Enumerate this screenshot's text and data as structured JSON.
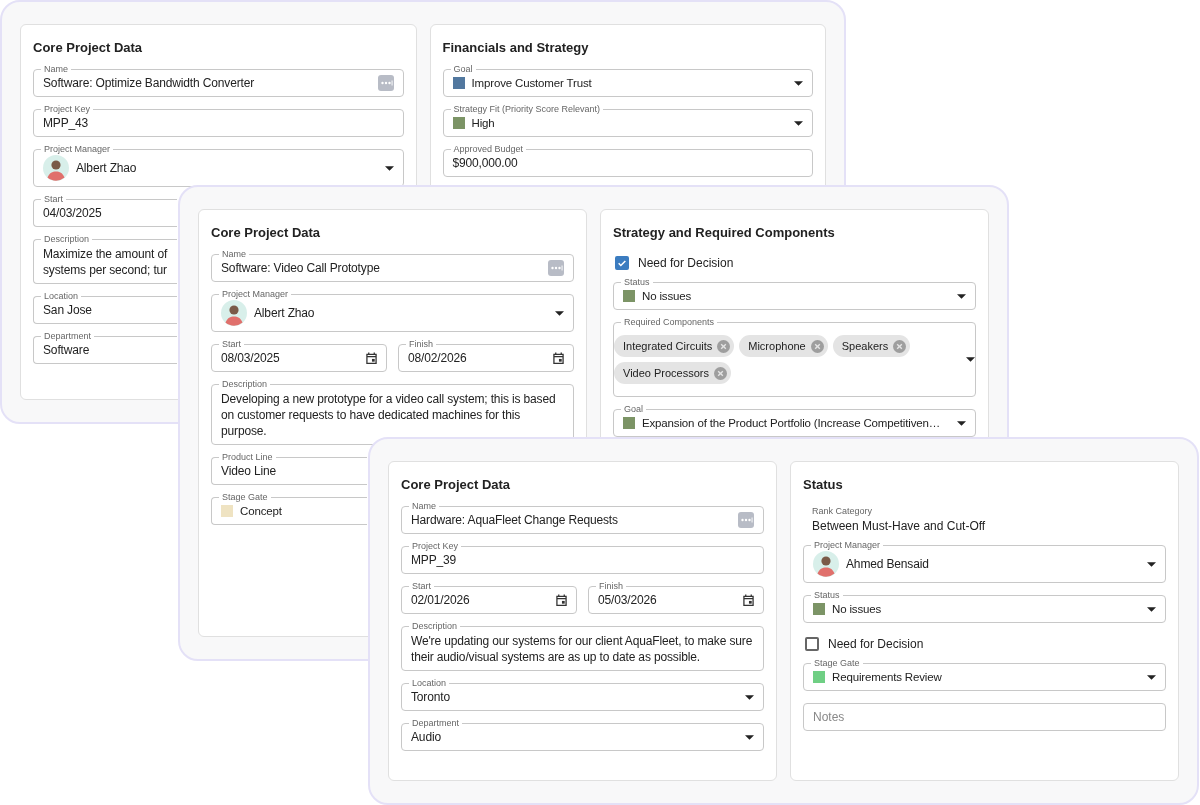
{
  "windows": [
    {
      "cards": [
        {
          "title": "Core Project Data",
          "fields": [
            {
              "kind": "name",
              "label": "Name",
              "value": "Software: Optimize Bandwidth Converter"
            },
            {
              "kind": "text",
              "label": "Project Key",
              "value": "MPP_43",
              "dropdown": false
            },
            {
              "kind": "person",
              "label": "Project Manager",
              "value": "Albert Zhao",
              "dropdown": true
            },
            {
              "kind": "text",
              "label": "Start",
              "value": "04/03/2025",
              "dropdown": false
            },
            {
              "kind": "textarea",
              "label": "Description",
              "value": "Maximize the amount of\nsystems per second; tur"
            },
            {
              "kind": "text",
              "label": "Location",
              "value": "San Jose",
              "dropdown": false
            },
            {
              "kind": "text",
              "label": "Department",
              "value": "Software",
              "dropdown": false
            }
          ]
        },
        {
          "title": "Financials and Strategy",
          "fields": [
            {
              "kind": "color",
              "label": "Goal",
              "value": "Improve Customer Trust",
              "color": "#52789f",
              "dropdown": true
            },
            {
              "kind": "color",
              "label": "Strategy Fit (Priority Score Relevant)",
              "value": "High",
              "color": "#7c9466",
              "dropdown": true
            },
            {
              "kind": "text",
              "label": "Approved Budget",
              "value": "$900,000.00",
              "dropdown": false
            }
          ]
        }
      ]
    },
    {
      "cards": [
        {
          "title": "Core Project Data",
          "fields": [
            {
              "kind": "name",
              "label": "Name",
              "value": "Software: Video Call Prototype"
            },
            {
              "kind": "person",
              "label": "Project Manager",
              "value": "Albert Zhao",
              "dropdown": true
            },
            {
              "kind": "dates",
              "fields": [
                {
                  "label": "Start",
                  "value": "08/03/2025"
                },
                {
                  "label": "Finish",
                  "value": "08/02/2026"
                }
              ]
            },
            {
              "kind": "textarea",
              "label": "Description",
              "value": "Developing a new prototype for a video call system; this is based on customer requests to have dedicated machines for this purpose."
            },
            {
              "kind": "text",
              "label": "Product Line",
              "value": "Video Line",
              "dropdown": false
            },
            {
              "kind": "color",
              "label": "Stage Gate",
              "value": "Concept",
              "color": "#efe3c2",
              "dropdown": false
            }
          ]
        },
        {
          "title": "Strategy and Required Components",
          "fields": [
            {
              "kind": "checkbox",
              "label": "Need for Decision",
              "checked": true
            },
            {
              "kind": "color",
              "label": "Status",
              "value": "No issues",
              "color": "#7c9466",
              "dropdown": true
            },
            {
              "kind": "chips",
              "label": "Required Components",
              "items": [
                "Integrated Circuits",
                "Microphone",
                "Speakers",
                "Video Processors"
              ],
              "dropdown": true
            },
            {
              "kind": "color",
              "label": "Goal",
              "value": "Expansion of the Product Portfolio (Increase Competitiven…",
              "color": "#7c9466",
              "dropdown": true
            }
          ]
        }
      ]
    },
    {
      "cards": [
        {
          "title": "Core Project Data",
          "fields": [
            {
              "kind": "name",
              "label": "Name",
              "value": "Hardware: AquaFleet Change Requests"
            },
            {
              "kind": "text",
              "label": "Project Key",
              "value": "MPP_39",
              "dropdown": false
            },
            {
              "kind": "dates",
              "fields": [
                {
                  "label": "Start",
                  "value": "02/01/2026"
                },
                {
                  "label": "Finish",
                  "value": "05/03/2026"
                }
              ]
            },
            {
              "kind": "textarea",
              "label": "Description",
              "value": "We're updating our systems for our client AquaFleet, to make sure their audio/visual systems are as up to date as possible."
            },
            {
              "kind": "text",
              "label": "Location",
              "value": "Toronto",
              "dropdown": true
            },
            {
              "kind": "text",
              "label": "Department",
              "value": "Audio",
              "dropdown": true
            }
          ]
        },
        {
          "title": "Status",
          "fields": [
            {
              "kind": "readonly",
              "label": "Rank Category",
              "value": "Between Must-Have and Cut-Off"
            },
            {
              "kind": "person",
              "label": "Project Manager",
              "value": "Ahmed Bensaid",
              "dropdown": true
            },
            {
              "kind": "color",
              "label": "Status",
              "value": "No issues",
              "color": "#7c9466",
              "dropdown": true
            },
            {
              "kind": "checkbox",
              "label": "Need for Decision",
              "checked": false
            },
            {
              "kind": "color",
              "label": "Stage Gate",
              "value": "Requirements Review",
              "color": "#6fcf84",
              "dropdown": true
            },
            {
              "kind": "notes",
              "placeholder": "Notes"
            }
          ]
        }
      ]
    }
  ]
}
